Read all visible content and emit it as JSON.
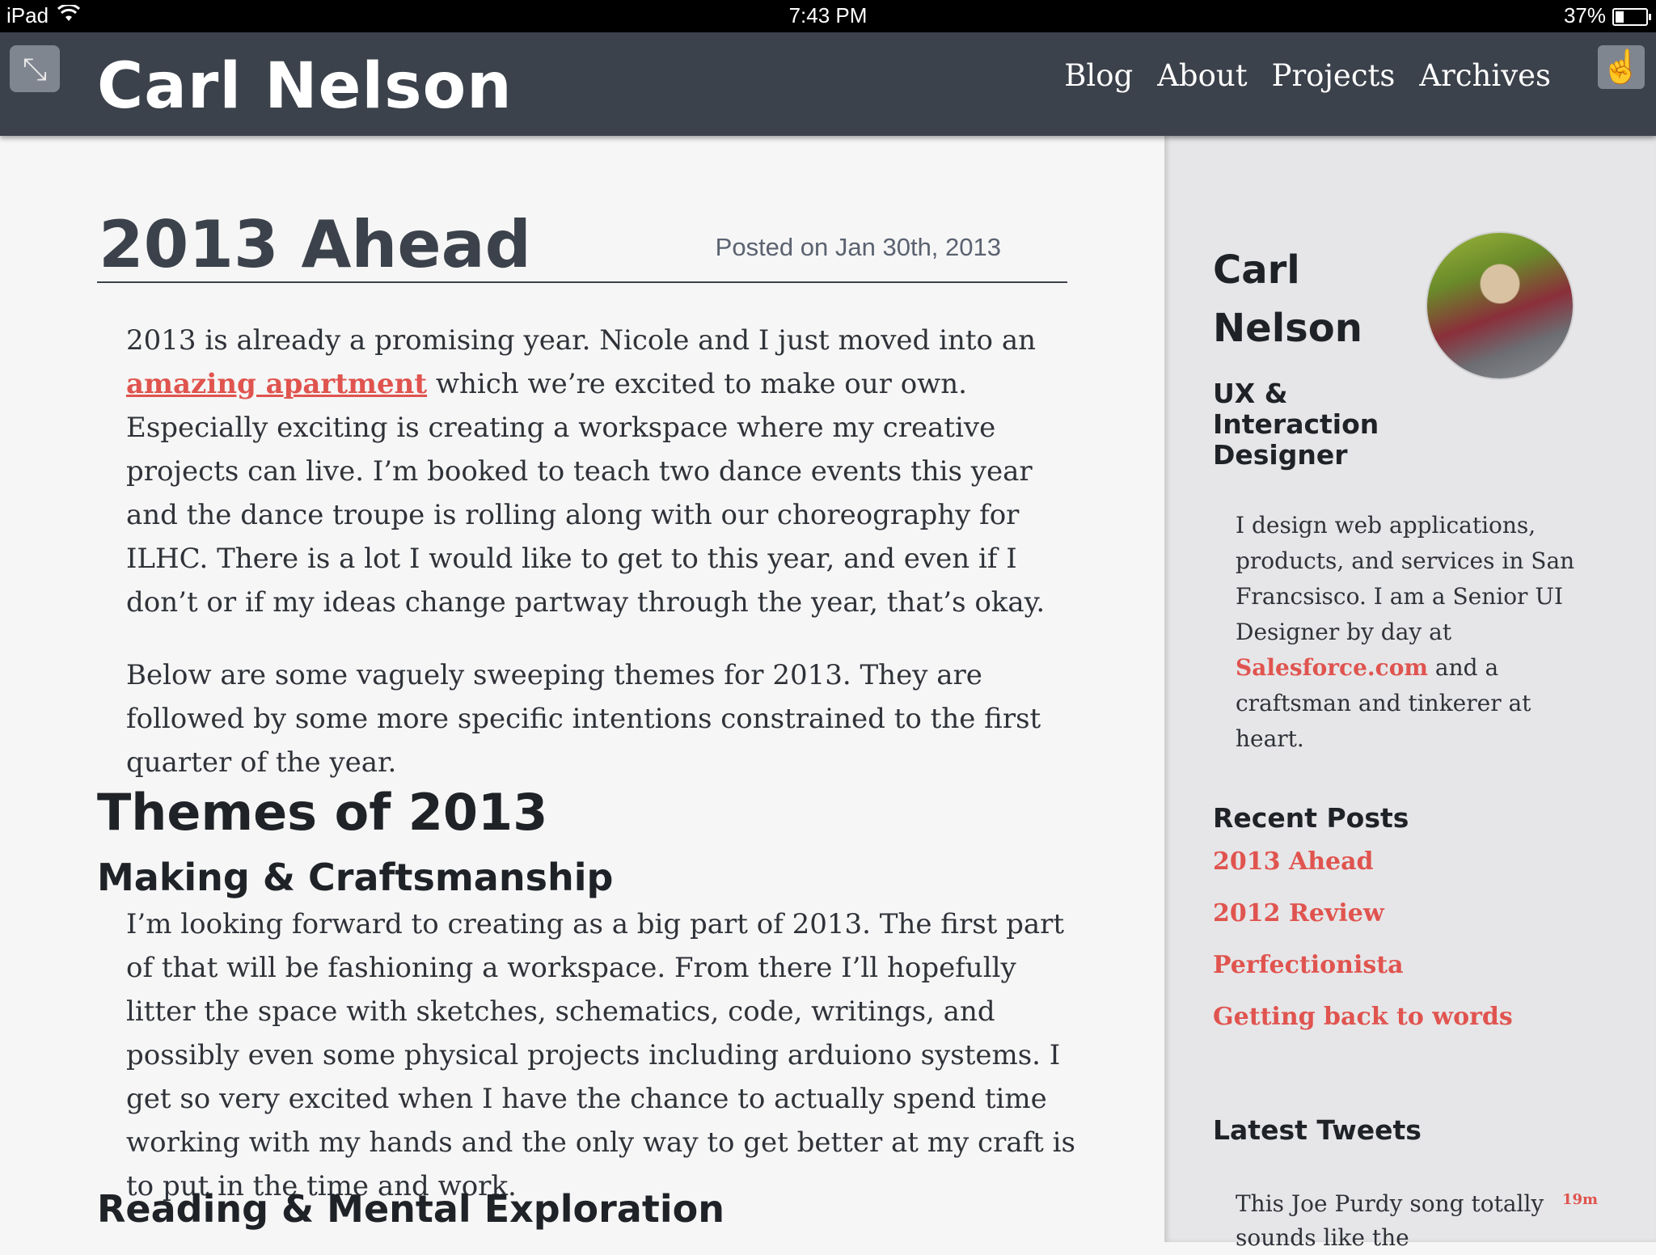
{
  "status_bar": {
    "device": "iPad",
    "time": "7:43 PM",
    "battery": "37%"
  },
  "header": {
    "title": "Carl Nelson",
    "nav": [
      "Blog",
      "About",
      "Projects",
      "Archives"
    ]
  },
  "post": {
    "title": "2013 Ahead",
    "date": "Posted on Jan 30th, 2013",
    "p1_pre": "2013 is already a promising year. Nicole and I just moved into an ",
    "p1_link": "amazing apartment",
    "p1_post": " which we’re excited to make our own. Especially exciting is creating a workspace where my creative projects can live. I’m booked to teach two dance events this year and the dance troupe is rolling along with our choreography for ILHC. There is a lot I would like to get to this year, and even if I don’t or if my ideas change partway through the year, that’s okay.",
    "p2": "Below are some vaguely sweeping themes for 2013. They are followed by some more specific intentions constrained to the first quarter of the year.",
    "themes_heading": "Themes of 2013",
    "making_heading": "Making & Craftsmanship",
    "p3": "I’m looking forward to creating as a big part of 2013. The first part of that will be fashioning a workspace. From there I’ll hopefully litter the space with sketches, schematics, code, writings, and possibly even some physical projects including arduiono systems. I get so very excited when I have the chance to actually spend time working with my hands and the only way to get better at my craft is to put in the time and work.",
    "reading_heading": "Reading & Mental Exploration"
  },
  "sidebar": {
    "name": "Carl Nelson",
    "role": "UX & Interaction Designer",
    "bio_pre": "I design web applications, products, and services in San Francsisco. I am a Senior UI Designer by day at ",
    "bio_link": "Salesforce.com",
    "bio_post": " and a craftsman and tinkerer at heart.",
    "recent_heading": "Recent Posts",
    "recent_posts": [
      "2013 Ahead",
      "2012 Review",
      "Perfectionista",
      "Getting back to words"
    ],
    "tweets_heading": "Latest Tweets",
    "tweet_text": "This Joe Purdy song totally sounds like the",
    "tweet_time": "19m"
  },
  "icons": {
    "collapse": "collapse-arrows-icon",
    "pointer": "hand-pointer-icon",
    "wifi": "wifi-icon",
    "battery": "battery-icon"
  },
  "colors": {
    "header_bg": "#3c424b",
    "link": "#e0544f",
    "sidebar_bg": "#e6e6e8"
  }
}
